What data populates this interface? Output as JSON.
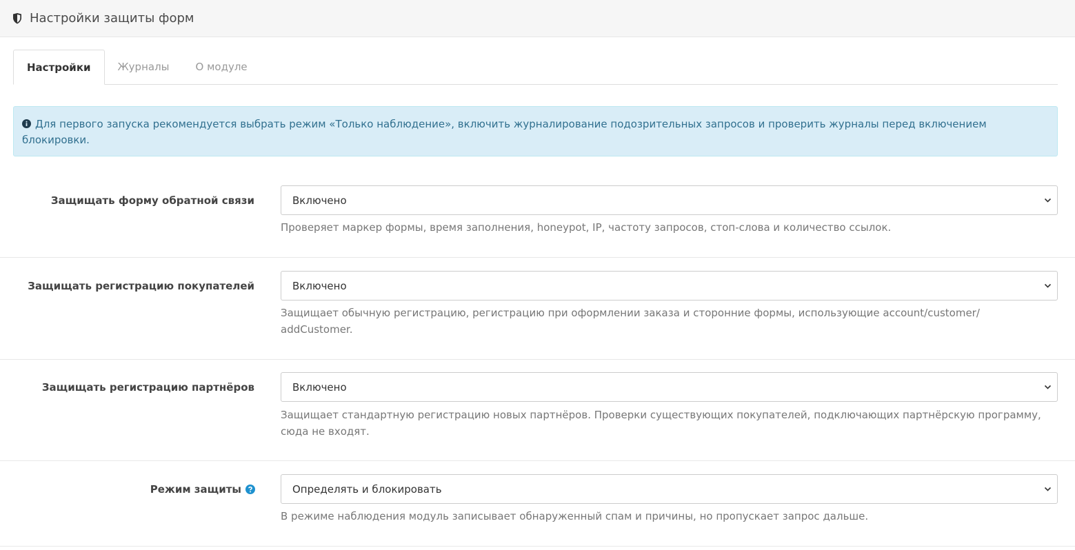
{
  "header": {
    "title": "Настройки защиты форм",
    "icon": "shield-icon"
  },
  "tabs": [
    {
      "label": "Настройки",
      "active": true
    },
    {
      "label": "Журналы",
      "active": false
    },
    {
      "label": "О модуле",
      "active": false
    }
  ],
  "alert": {
    "icon": "info-circle-icon",
    "text": "Для первого запуска рекомендуется выбрать режим «Только наблюдение», включить журналирование подозрительных запросов и проверить журналы перед включением блокировки."
  },
  "fields": {
    "contact": {
      "label": "Защищать форму обратной связи",
      "value": "Включено",
      "help": "Проверяет маркер формы, время заполнения, honeypot, IP, частоту запросов, стоп-слова и количество ссылок."
    },
    "customer": {
      "label": "Защищать регистрацию покупателей",
      "value": "Включено",
      "help": "Защищает обычную регистрацию, регистрацию при оформлении заказа и сторонние формы, использующие account/customer/ addCustomer."
    },
    "affiliate": {
      "label": "Защищать регистрацию партнёров",
      "value": "Включено",
      "help": "Защищает стандартную регистрацию новых партнёров. Проверки существующих покупателей, подключающих партнёрскую программу, сюда не входят."
    },
    "mode": {
      "label": "Режим защиты",
      "value": "Определять и блокировать",
      "help": "В режиме наблюдения модуль записывает обнаруженный спам и причины, но пропускает запрос дальше."
    }
  },
  "colors": {
    "alert_bg": "#d9edf7",
    "alert_text": "#31708f",
    "help_icon": "#1e91cf"
  }
}
